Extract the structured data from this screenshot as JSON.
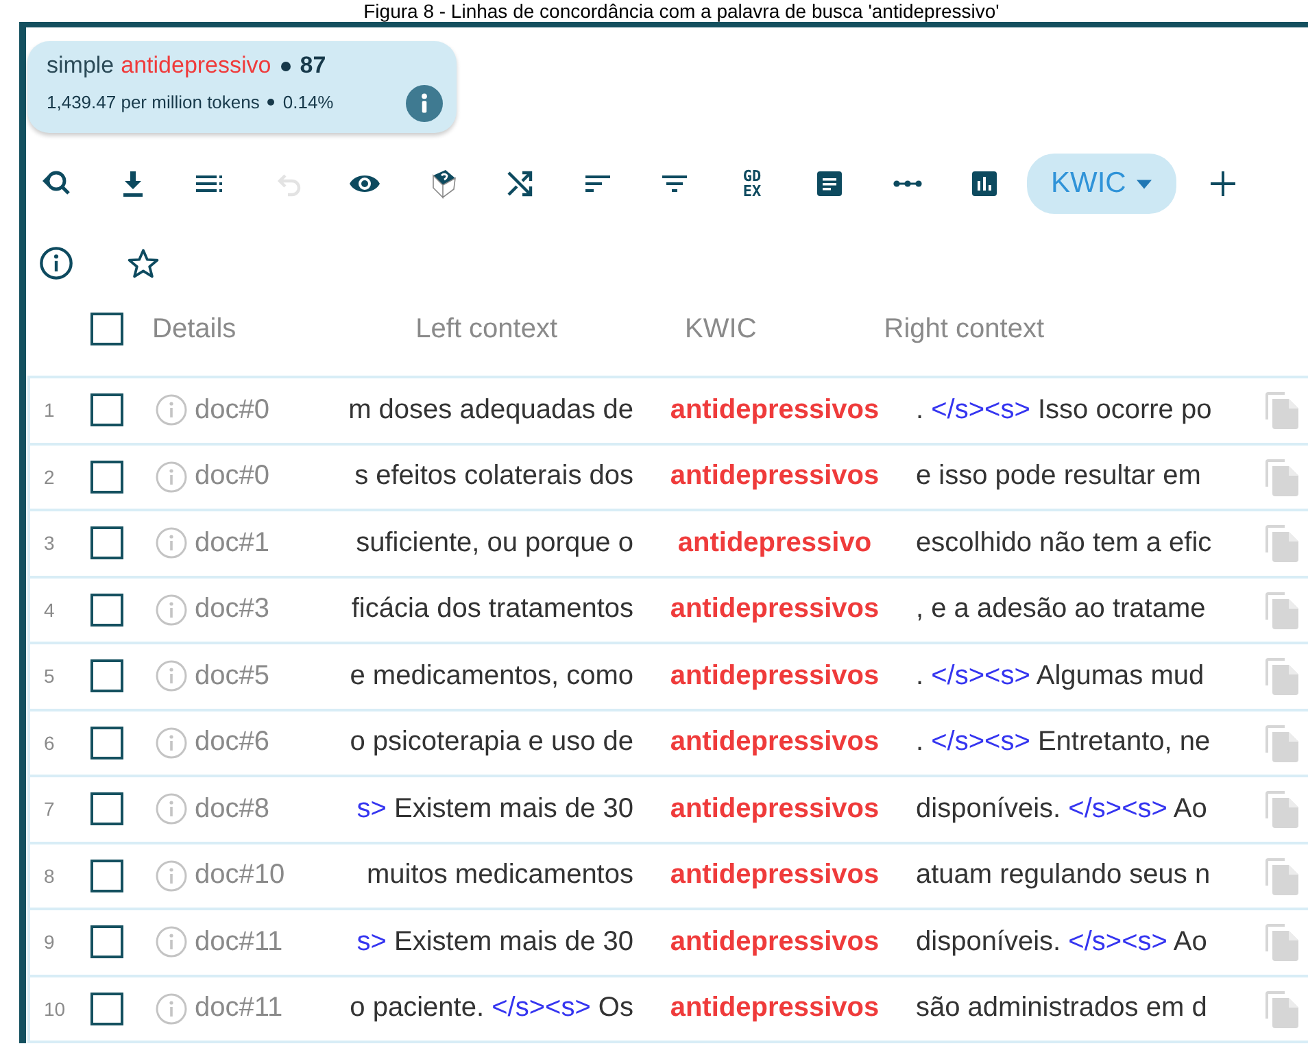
{
  "caption": "Figura 8 - Linhas de concordância com a palavra de busca 'antidepressivo'",
  "summary": {
    "query_type": "simple",
    "term": "antidepressivo",
    "hits": "87",
    "per_million": "1,439.47 per million tokens",
    "percent": "0.14%"
  },
  "toolbar": {
    "undo_disabled": true,
    "gdex": [
      "GD",
      "EX"
    ],
    "view_button": "KWIC"
  },
  "columns": {
    "select_all_checked": false,
    "details": "Details",
    "left": "Left context",
    "kwic": "KWIC",
    "right": "Right context"
  },
  "rows": [
    {
      "num": "1",
      "checked": false,
      "doc": "doc#0",
      "left": [
        {
          "kind": "text",
          "text": "m doses adequadas de"
        }
      ],
      "kwic": "antidepressivos",
      "right": [
        {
          "kind": "text",
          "text": ". "
        },
        {
          "kind": "tag",
          "text": "</s><s>"
        },
        {
          "kind": "text",
          "text": " Isso ocorre po"
        }
      ]
    },
    {
      "num": "2",
      "checked": false,
      "doc": "doc#0",
      "left": [
        {
          "kind": "text",
          "text": "s efeitos colaterais dos"
        }
      ],
      "kwic": "antidepressivos",
      "right": [
        {
          "kind": "text",
          "text": "e isso pode resultar em"
        }
      ]
    },
    {
      "num": "3",
      "checked": false,
      "doc": "doc#1",
      "left": [
        {
          "kind": "text",
          "text": "suficiente, ou porque o"
        }
      ],
      "kwic": "antidepressivo",
      "right": [
        {
          "kind": "text",
          "text": "escolhido não tem a efic"
        }
      ]
    },
    {
      "num": "4",
      "checked": false,
      "doc": "doc#3",
      "left": [
        {
          "kind": "text",
          "text": "ficácia dos tratamentos"
        }
      ],
      "kwic": "antidepressivos",
      "right": [
        {
          "kind": "text",
          "text": ", e a adesão ao tratame"
        }
      ]
    },
    {
      "num": "5",
      "checked": false,
      "doc": "doc#5",
      "left": [
        {
          "kind": "text",
          "text": "e medicamentos, como"
        }
      ],
      "kwic": "antidepressivos",
      "right": [
        {
          "kind": "text",
          "text": ". "
        },
        {
          "kind": "tag",
          "text": "</s><s>"
        },
        {
          "kind": "text",
          "text": " Algumas mud"
        }
      ]
    },
    {
      "num": "6",
      "checked": false,
      "doc": "doc#6",
      "left": [
        {
          "kind": "text",
          "text": "o psicoterapia e uso de"
        }
      ],
      "kwic": "antidepressivos",
      "right": [
        {
          "kind": "text",
          "text": ". "
        },
        {
          "kind": "tag",
          "text": "</s><s>"
        },
        {
          "kind": "text",
          "text": " Entretanto, ne"
        }
      ]
    },
    {
      "num": "7",
      "checked": false,
      "doc": "doc#8",
      "left": [
        {
          "kind": "tag",
          "text": "s>"
        },
        {
          "kind": "text",
          "text": " Existem mais de 30"
        }
      ],
      "kwic": "antidepressivos",
      "right": [
        {
          "kind": "text",
          "text": "disponíveis. "
        },
        {
          "kind": "tag",
          "text": "</s><s>"
        },
        {
          "kind": "text",
          "text": " Ao"
        }
      ]
    },
    {
      "num": "8",
      "checked": false,
      "doc": "doc#10",
      "left": [
        {
          "kind": "text",
          "text": "muitos medicamentos"
        }
      ],
      "kwic": "antidepressivos",
      "right": [
        {
          "kind": "text",
          "text": "atuam regulando seus n"
        }
      ]
    },
    {
      "num": "9",
      "checked": false,
      "doc": "doc#11",
      "left": [
        {
          "kind": "tag",
          "text": "s>"
        },
        {
          "kind": "text",
          "text": " Existem mais de 30"
        }
      ],
      "kwic": "antidepressivos",
      "right": [
        {
          "kind": "text",
          "text": "disponíveis. "
        },
        {
          "kind": "tag",
          "text": "</s><s>"
        },
        {
          "kind": "text",
          "text": " Ao"
        }
      ]
    },
    {
      "num": "10",
      "checked": false,
      "doc": "doc#11",
      "left": [
        {
          "kind": "text",
          "text": "o paciente. "
        },
        {
          "kind": "tag",
          "text": "</s><s>"
        },
        {
          "kind": "text",
          "text": " Os"
        }
      ],
      "kwic": "antidepressivos",
      "right": [
        {
          "kind": "text",
          "text": "são administrados em d"
        }
      ]
    }
  ]
}
